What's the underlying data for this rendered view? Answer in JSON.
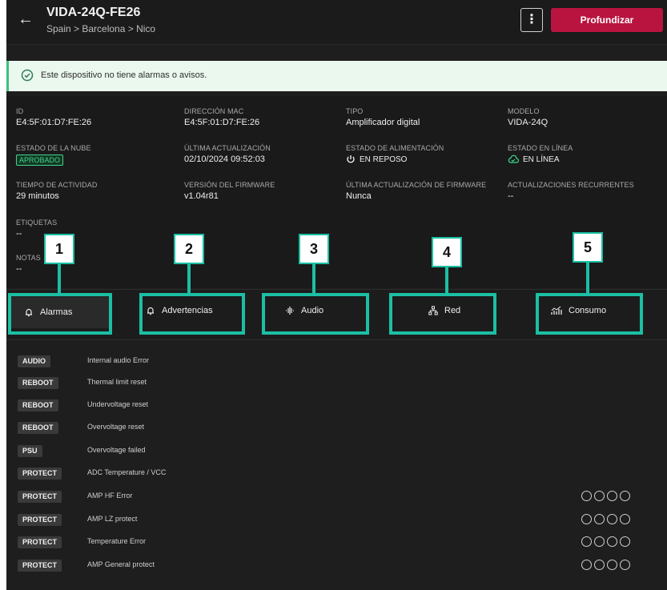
{
  "header": {
    "title": "VIDA-24Q-FE26",
    "breadcrumb": "Spain > Barcelona > Nico",
    "menu_label": "⋮",
    "primary_action": "Profundizar",
    "back_glyph": "←"
  },
  "alert": {
    "text": "Este dispositivo no tiene alarmas o avisos.",
    "icon": "check-circle-icon",
    "color": "#3fbf7f"
  },
  "details": {
    "id": {
      "label": "ID",
      "value": "E4:5F:01:D7:FE:26"
    },
    "mac": {
      "label": "DIRECCIÓN MAC",
      "value": "E4:5F:01:D7:FE:26"
    },
    "tipo": {
      "label": "TIPO",
      "value": "Amplificador digital"
    },
    "modelo": {
      "label": "MODELO",
      "value": "VIDA-24Q"
    },
    "cloud": {
      "label": "ESTADO DE LA NUBE",
      "value": "APROBADO"
    },
    "last_update": {
      "label": "ÚLTIMA ACTUALIZACIÓN",
      "value": "02/10/2024 09:52:03"
    },
    "power": {
      "label": "ESTADO DE ALIMENTACIÓN",
      "value": "EN REPOSO",
      "icon": "power-icon"
    },
    "online": {
      "label": "ESTADO EN LÍNEA",
      "value": "EN LÍNEA",
      "icon": "cloud-check-icon"
    },
    "activity": {
      "label": "TIEMPO DE ACTIVIDAD",
      "value": "29 minutos"
    },
    "firmware": {
      "label": "VERSIÓN DEL FIRMWARE",
      "value": "v1.04r81"
    },
    "fw_update": {
      "label": "ÚLTIMA ACTUALIZACIÓN DE FIRMWARE",
      "value": "Nunca"
    },
    "recurring": {
      "label": "ACTUALIZACIONES RECURRENTES",
      "value": "--"
    },
    "tags": {
      "label": "ETIQUETAS",
      "value": "--"
    },
    "notes": {
      "label": "NOTAS",
      "value": "--"
    }
  },
  "tabs": [
    {
      "label": "Alarmas",
      "icon": "bell-icon"
    },
    {
      "label": "Advertencias",
      "icon": "bell-icon"
    },
    {
      "label": "Audio",
      "icon": "audio-wave-icon"
    },
    {
      "label": "Red",
      "icon": "network-icon"
    },
    {
      "label": "Consumo",
      "icon": "chart-icon"
    }
  ],
  "callouts": [
    "1",
    "2",
    "3",
    "4",
    "5"
  ],
  "alarms": [
    {
      "tag": "AUDIO",
      "desc": "Internal audio Error",
      "circles": false
    },
    {
      "tag": "REBOOT",
      "desc": "Thermal limit reset",
      "circles": false
    },
    {
      "tag": "REBOOT",
      "desc": "Undervoltage reset",
      "circles": false
    },
    {
      "tag": "REBOOT",
      "desc": "Overvoltage reset",
      "circles": false
    },
    {
      "tag": "PSU",
      "desc": "Overvoltage failed",
      "circles": false
    },
    {
      "tag": "PROTECT",
      "desc": "ADC Temperature / VCC",
      "circles": false
    },
    {
      "tag": "PROTECT",
      "desc": "AMP HF Error",
      "circles": true
    },
    {
      "tag": "PROTECT",
      "desc": "AMP LZ protect",
      "circles": true
    },
    {
      "tag": "PROTECT",
      "desc": "Temperature Error",
      "circles": true
    },
    {
      "tag": "PROTECT",
      "desc": "AMP General protect",
      "circles": true
    }
  ],
  "colors": {
    "accent": "#b8143f",
    "highlight": "#1bbfa4",
    "success": "#3fd48a"
  }
}
